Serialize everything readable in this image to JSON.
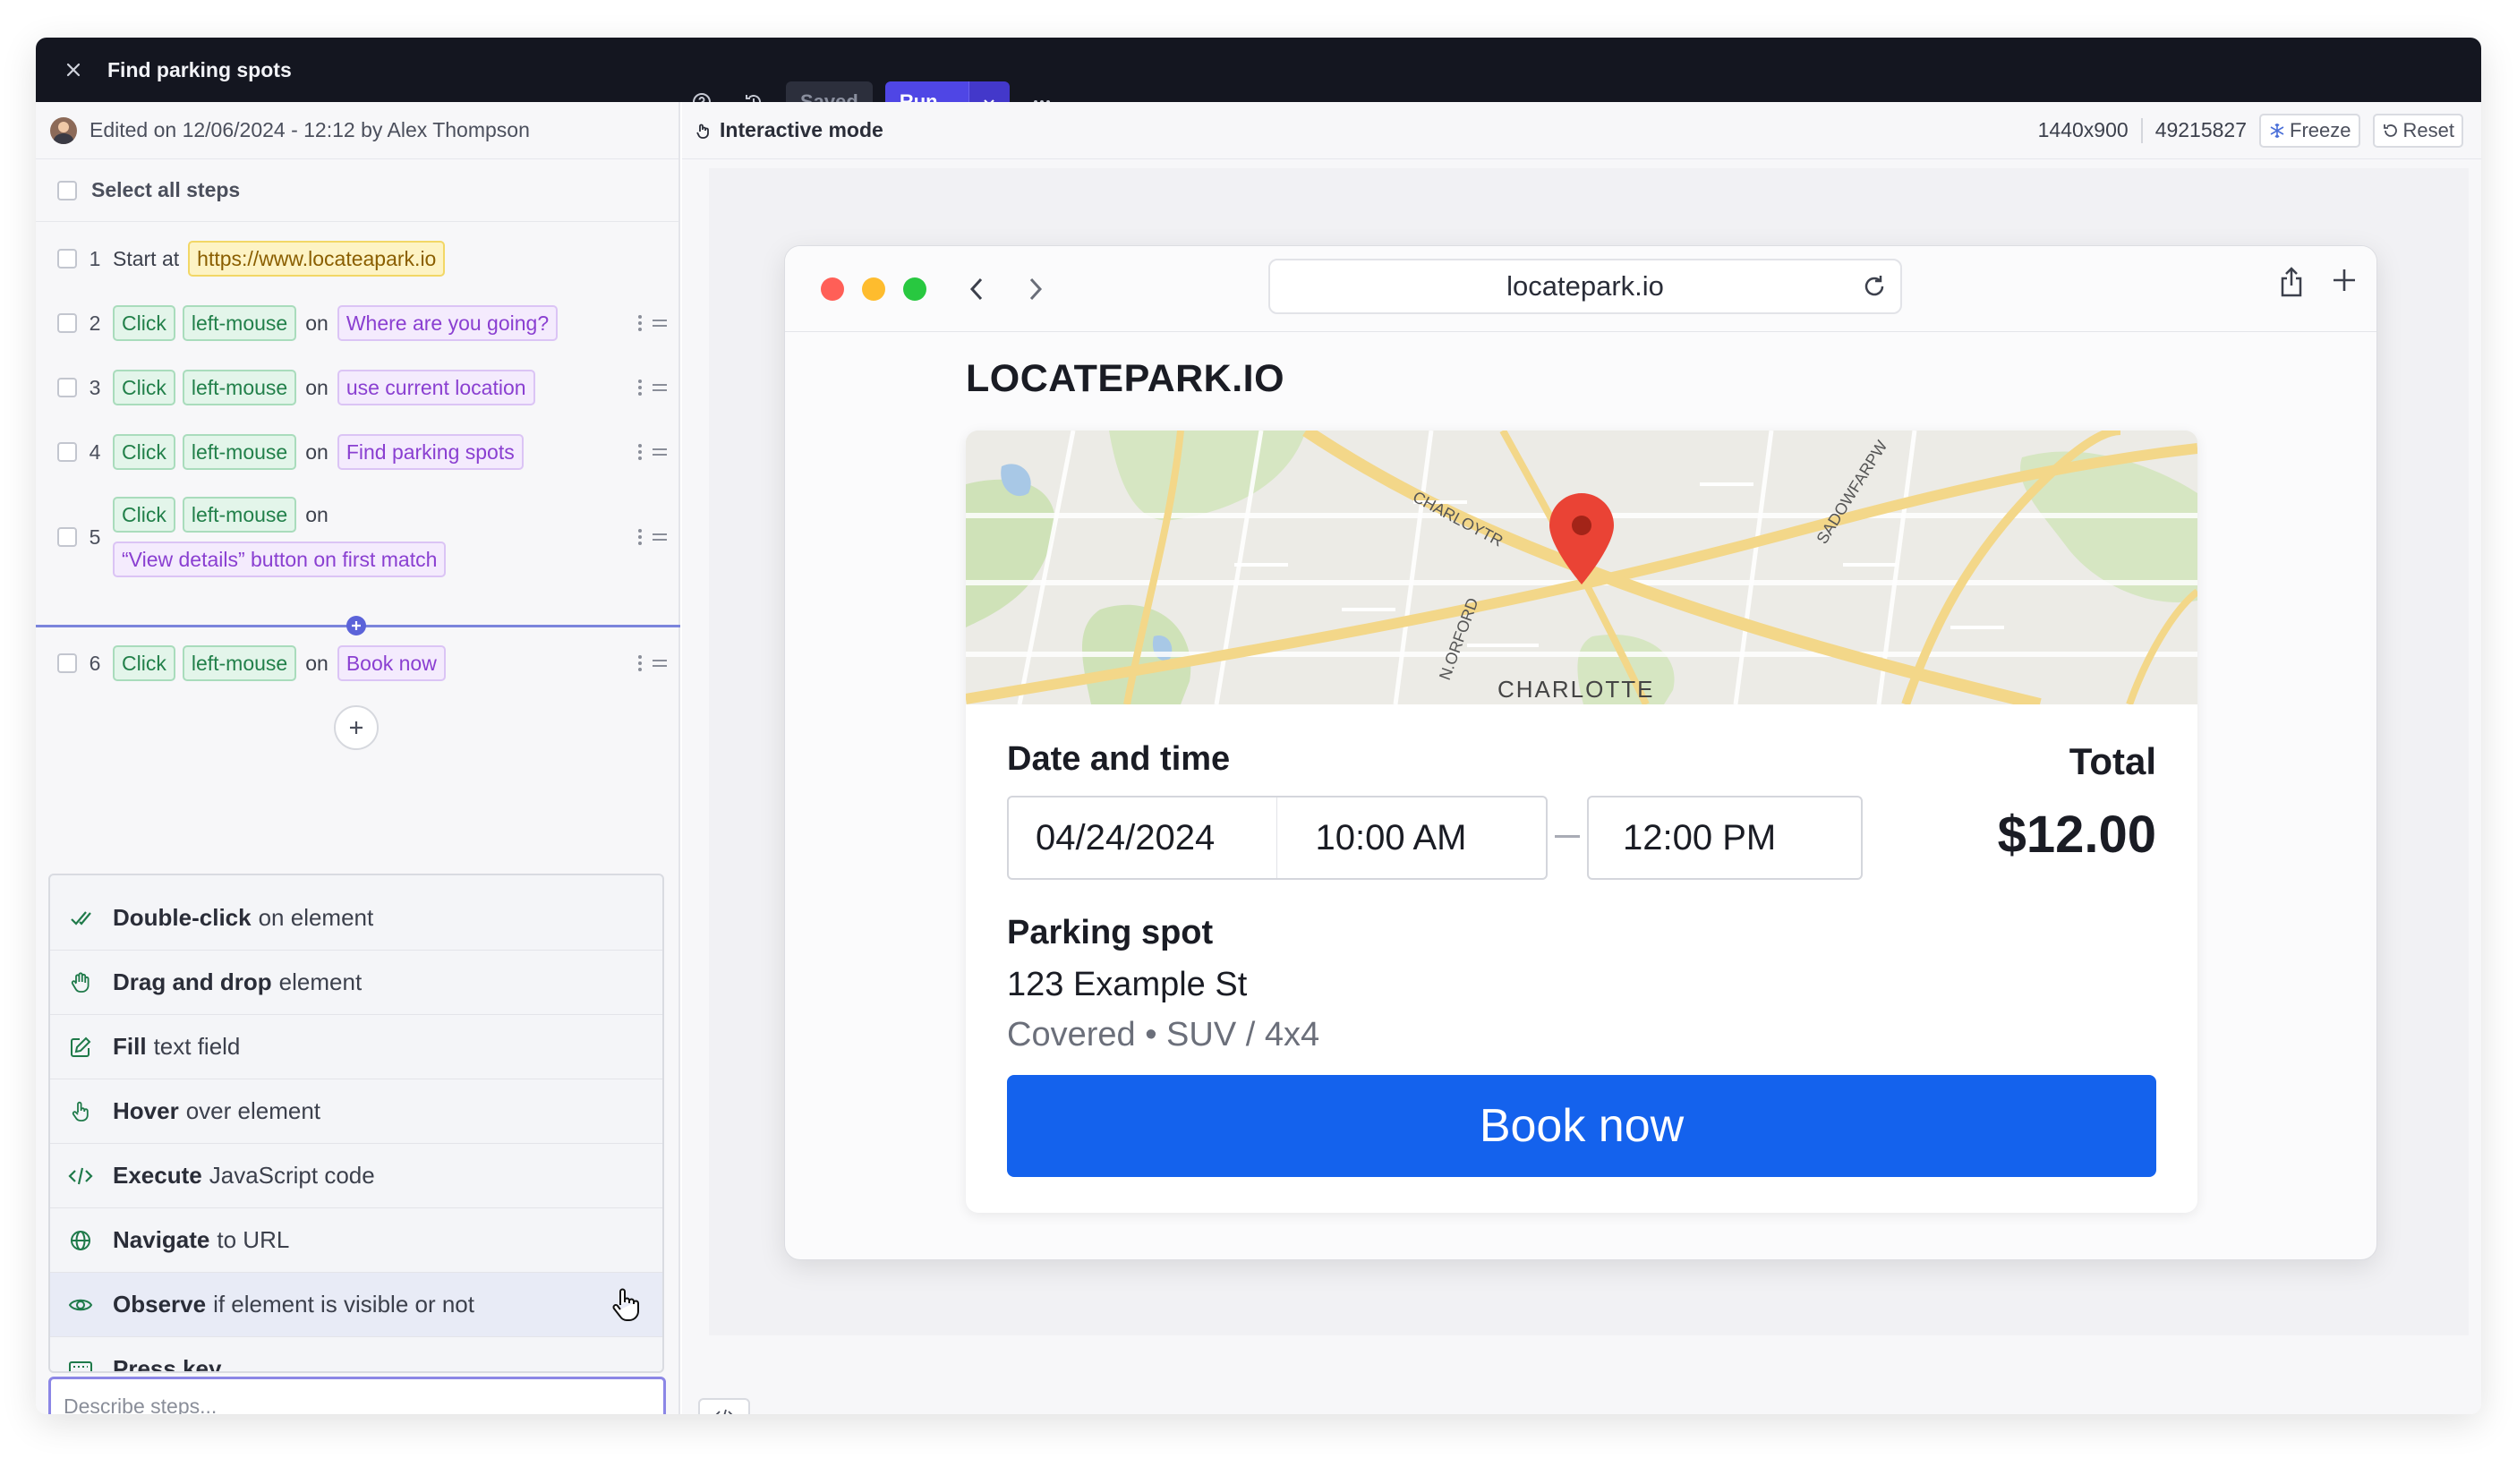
{
  "window": {
    "title": "Find parking spots",
    "saved_label": "Saved",
    "run_label": "Run..."
  },
  "editor": {
    "edited_text": "Edited on 12/06/2024 - 12:12 by Alex Thompson",
    "select_all_label": "Select all steps",
    "on_word": "on",
    "start_text": "Start at",
    "steps": [
      {
        "num": "1",
        "url": "https://www.locateapark.io"
      },
      {
        "num": "2",
        "action": "Click",
        "button": "left-mouse",
        "target": "Where are you going?"
      },
      {
        "num": "3",
        "action": "Click",
        "button": "left-mouse",
        "target": "use current location"
      },
      {
        "num": "4",
        "action": "Click",
        "button": "left-mouse",
        "target": "Find parking spots"
      },
      {
        "num": "5",
        "action": "Click",
        "button": "left-mouse",
        "target": "“View details” button on first match"
      },
      {
        "num": "6",
        "action": "Click",
        "button": "left-mouse",
        "target": "Book now"
      }
    ],
    "menu": [
      {
        "bold": "Double-click",
        "rest": "on element",
        "icon": "check-double-icon"
      },
      {
        "bold": "Drag and drop",
        "rest": "element",
        "icon": "hand-drag-icon"
      },
      {
        "bold": "Fill",
        "rest": "text field",
        "icon": "edit-icon"
      },
      {
        "bold": "Hover",
        "rest": "over element",
        "icon": "pointer-hand-icon"
      },
      {
        "bold": "Execute",
        "rest": "JavaScript code",
        "icon": "code-icon"
      },
      {
        "bold": "Navigate",
        "rest": "to URL",
        "icon": "globe-icon"
      },
      {
        "bold": "Observe",
        "rest": "if element is visible or not",
        "icon": "eye-icon"
      },
      {
        "bold": "Press key",
        "rest": "",
        "icon": "keyboard-icon"
      }
    ],
    "describe_placeholder": "Describe steps..."
  },
  "preview": {
    "mode_label": "Interactive mode",
    "resolution": "1440x900",
    "session_id": "49215827",
    "freeze_label": "Freeze",
    "reset_label": "Reset",
    "browser": {
      "url": "locatepark.io"
    },
    "site": {
      "brand": "LOCATEPARK.IO",
      "map_labels": [
        "CHARLOYTR",
        "N.ORFORD",
        "SADOWFARPW",
        "CHARLOTTE"
      ],
      "date_time_title": "Date and time",
      "date": "04/24/2024",
      "start_time": "10:00 AM",
      "end_time": "12:00 PM",
      "total_label": "Total",
      "total_value": "$12.00",
      "parking_title": "Parking spot",
      "address": "123 Example St",
      "meta": "Covered • SUV / 4x4",
      "book_label": "Book now"
    }
  },
  "colors": {
    "accent": "#4f46e5",
    "book_button": "#1462ed",
    "action_chip": "#22804a",
    "target_chip": "#8a3fd1",
    "url_chip": "#8a5e00"
  }
}
